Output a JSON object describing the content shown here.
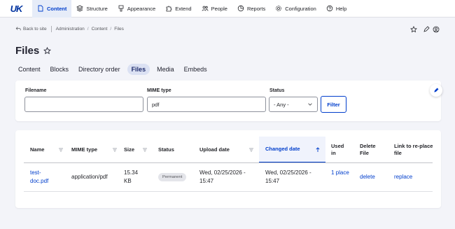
{
  "toolbar": {
    "logo_text": "UK",
    "items": [
      {
        "label": "Content",
        "icon": "file-icon",
        "active": true
      },
      {
        "label": "Structure",
        "icon": "layers-icon"
      },
      {
        "label": "Appearance",
        "icon": "brush-icon"
      },
      {
        "label": "Extend",
        "icon": "puzzle-icon"
      },
      {
        "label": "People",
        "icon": "people-icon"
      },
      {
        "label": "Reports",
        "icon": "chart-icon"
      },
      {
        "label": "Configuration",
        "icon": "gear-icon"
      },
      {
        "label": "Help",
        "icon": "help-icon"
      }
    ],
    "accent": "#003ecc"
  },
  "subbar": {
    "back_label": "Back to site",
    "breadcrumb": [
      "Administration",
      "Content",
      "Files"
    ],
    "crumb_separator": "/"
  },
  "page": {
    "title": "Files"
  },
  "tabs": [
    {
      "label": "Content"
    },
    {
      "label": "Blocks"
    },
    {
      "label": "Directory order"
    },
    {
      "label": "Files",
      "active": true
    },
    {
      "label": "Media"
    },
    {
      "label": "Embeds"
    }
  ],
  "filters": {
    "filename_label": "Filename",
    "filename_value": "",
    "mime_label": "MIME type",
    "mime_value": "pdf",
    "status_label": "Status",
    "status_value": "- Any -",
    "filter_button": "Filter"
  },
  "table": {
    "columns": {
      "name": "Name",
      "mime": "MIME type",
      "size": "Size",
      "status": "Status",
      "upload": "Upload date",
      "changed": "Changed date",
      "used_in": "Used in",
      "delete": "Delete File",
      "replace": "Link to re-place file"
    },
    "rows": [
      {
        "name": "test-doc.pdf",
        "mime": "application/pdf",
        "size": "15.34 KB",
        "status": "Permanent",
        "upload": "Wed, 02/25/2026 - 15:47",
        "changed": "Wed, 02/25/2026 - 15:47",
        "used_in": "1 place",
        "delete": "delete",
        "replace": "replace"
      }
    ]
  }
}
